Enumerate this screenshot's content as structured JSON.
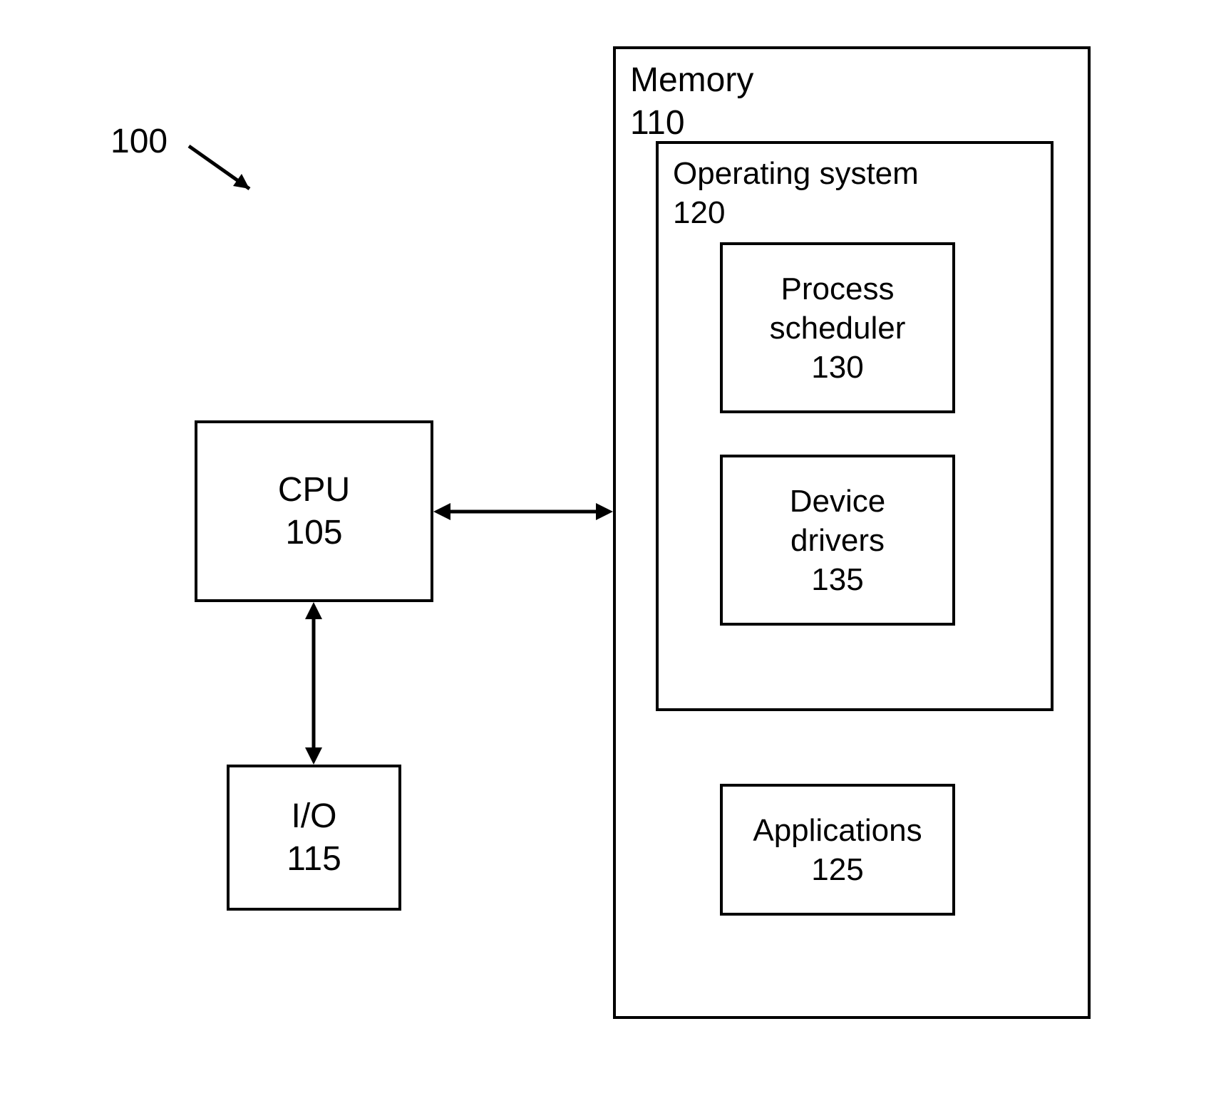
{
  "figure_ref": "100",
  "cpu": {
    "label": "CPU",
    "num": "105"
  },
  "io": {
    "label": "I/O",
    "num": "115"
  },
  "memory": {
    "label": "Memory",
    "num": "110"
  },
  "os": {
    "label": "Operating system",
    "num": "120"
  },
  "scheduler": {
    "line1": "Process",
    "line2": "scheduler",
    "num": "130"
  },
  "drivers": {
    "line1": "Device",
    "line2": "drivers",
    "num": "135"
  },
  "apps": {
    "label": "Applications",
    "num": "125"
  }
}
